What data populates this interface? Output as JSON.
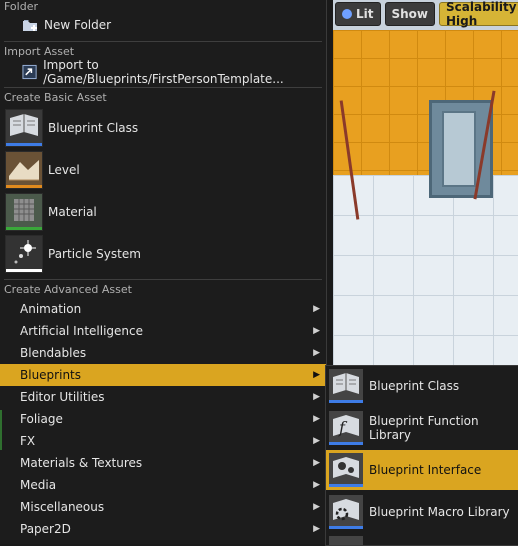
{
  "viewport": {
    "lit_label": "Lit",
    "show_label": "Show",
    "scalability_label": "Scalability: High"
  },
  "menu": {
    "folder_section": "Folder",
    "new_folder": "New Folder",
    "import_section": "Import Asset",
    "import_label": "Import to /Game/Blueprints/FirstPersonTemplate...",
    "basic_section": "Create Basic Asset",
    "basic_items": [
      {
        "label": "Blueprint Class",
        "icon": "blueprint-class-icon",
        "bar_color": "#3e7ce6"
      },
      {
        "label": "Level",
        "icon": "level-icon",
        "bar_color": "#e08a1e"
      },
      {
        "label": "Material",
        "icon": "material-icon",
        "bar_color": "#3aa83a"
      },
      {
        "label": "Particle System",
        "icon": "particle-system-icon",
        "bar_color": "#ffffff"
      }
    ],
    "advanced_section": "Create Advanced Asset",
    "advanced_items": [
      "Animation",
      "Artificial Intelligence",
      "Blendables",
      "Blueprints",
      "Editor Utilities",
      "Foliage",
      "FX",
      "Materials & Textures",
      "Media",
      "Miscellaneous",
      "Paper2D"
    ],
    "selected_advanced": "Blueprints"
  },
  "submenu": {
    "items": [
      {
        "label": "Blueprint Class",
        "icon": "blueprint-class-icon"
      },
      {
        "label": "Blueprint Function Library",
        "icon": "function-library-icon"
      },
      {
        "label": "Blueprint Interface",
        "icon": "blueprint-interface-icon"
      },
      {
        "label": "Blueprint Macro Library",
        "icon": "macro-library-icon"
      }
    ],
    "selected": "Blueprint Interface"
  },
  "colors": {
    "selection": "#daa520",
    "blueprint_bar": "#3e7ce6"
  }
}
